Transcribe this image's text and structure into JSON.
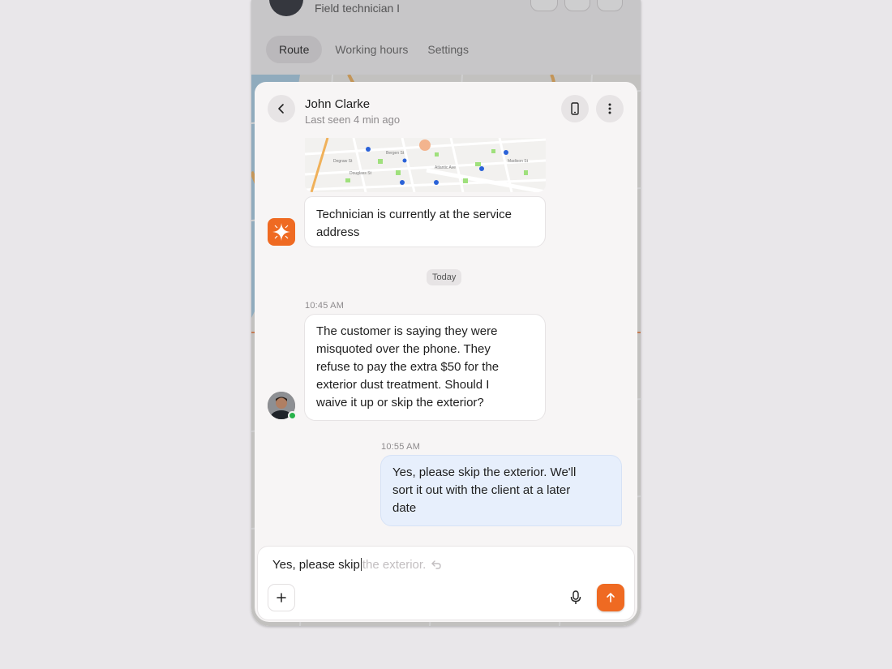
{
  "background_app": {
    "subtitle": "Field technician I",
    "tabs": [
      {
        "label": "Route",
        "active": true
      },
      {
        "label": "Working hours",
        "active": false
      },
      {
        "label": "Settings",
        "active": false
      }
    ]
  },
  "chat": {
    "contact": {
      "name": "John Clarke",
      "status": "Last seen 4 min ago"
    },
    "icons": {
      "back": "chevron-left-icon",
      "device": "phone-icon",
      "more": "more-vertical-icon"
    },
    "map_attachment": {
      "caption": "Technician is currently at the service address"
    },
    "date_divider": "Today",
    "messages": [
      {
        "direction": "incoming",
        "time": "10:45 AM",
        "lines": [
          "The customer is saying they were",
          "misquoted over the phone. They",
          "refuse to pay the extra $50 for the",
          "exterior dust treatment. Should I",
          "waive it up or skip the exterior?"
        ]
      },
      {
        "direction": "outgoing",
        "time": "10:55 AM",
        "lines": [
          "Yes, please skip the exterior. We'll",
          "sort it out with the client at a later",
          "date"
        ]
      }
    ],
    "composer": {
      "typed": "Yes, please skip",
      "suggestion": "the exterior.",
      "icons": {
        "attach": "plus-icon",
        "mic": "microphone-icon",
        "send": "arrow-up-icon",
        "accept_suggestion": "return-arrow-icon"
      }
    }
  },
  "colors": {
    "accent": "#ef6a22",
    "outgoing_bubble": "#e7effc",
    "online": "#27b34a",
    "sheet_bg": "#f7f5f5"
  }
}
